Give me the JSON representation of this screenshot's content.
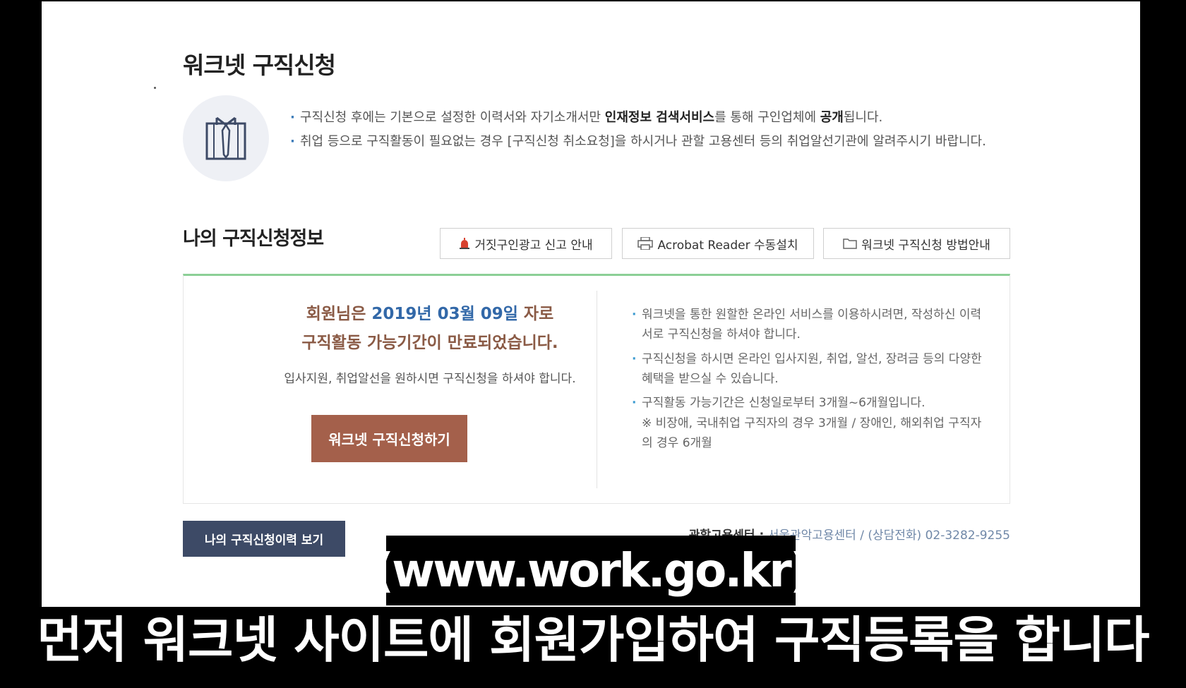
{
  "header": {
    "title": "워크넷 구직신청"
  },
  "notices": [
    {
      "bullet": "·",
      "parts": [
        "구직신청 후에는 기본으로 설정한 이력서와 자기소개서만 ",
        "인재정보 검색서비스",
        "를 통해 구인업체에 ",
        "공개",
        "됩니다."
      ]
    },
    {
      "bullet": "·",
      "text": "취업 등으로 구직활동이 필요없는 경우 [구직신청 취소요청]을 하시거나 관할 고용센터 등의 취업알선기관에 알려주시기 바랍니다."
    }
  ],
  "section": {
    "title": "나의 구직신청정보",
    "buttons": [
      {
        "label": "거짓구인광고 신고 안내",
        "icon": "siren-icon"
      },
      {
        "label": "Acrobat Reader 수동설치",
        "icon": "printer-icon"
      },
      {
        "label": "워크넷 구직신청 방법안내",
        "icon": "folder-icon"
      }
    ]
  },
  "status": {
    "prefix": "회원님은 ",
    "date": "2019년 03월 09일",
    "suffix": " 자로",
    "line2": "구직활동 가능기간이 만료되었습니다.",
    "line3": "입사지원, 취업알선을 원하시면 구직신청을 하셔야 합니다.",
    "apply_label": "워크넷 구직신청하기"
  },
  "right_notes": [
    "워크넷을 통한 원할한 온라인 서비스를 이용하시려면, 작성하신 이력서로 구직신청을 하셔야 합니다.",
    "구직신청을 하시면 온라인 입사지원, 취업, 알선, 장려금 등의 다양한 혜택을 받으실 수 있습니다.",
    "구직활동 가능기간은 신청일로부터 3개월~6개월입니다.",
    "※ 비장애, 국내취업 구직자의 경우 3개월 / 장애인, 해외취업 구직자의 경우 6개월"
  ],
  "footer": {
    "history_label": "나의 구직신청이력 보기",
    "center_label": "관할고용센터 :",
    "center_value": "서울관악고용센터 / (상담전화) 02-3282-9255"
  },
  "captions": {
    "url": "(www.work.go.kr)",
    "subtitle": "먼저 워크넷 사이트에 회원가입하여 구직등록을 합니다"
  },
  "colors": {
    "accent_green": "#8ccf96",
    "apply_button": "#a4604b",
    "history_button": "#3d4a66",
    "date_blue": "#3268a8"
  }
}
